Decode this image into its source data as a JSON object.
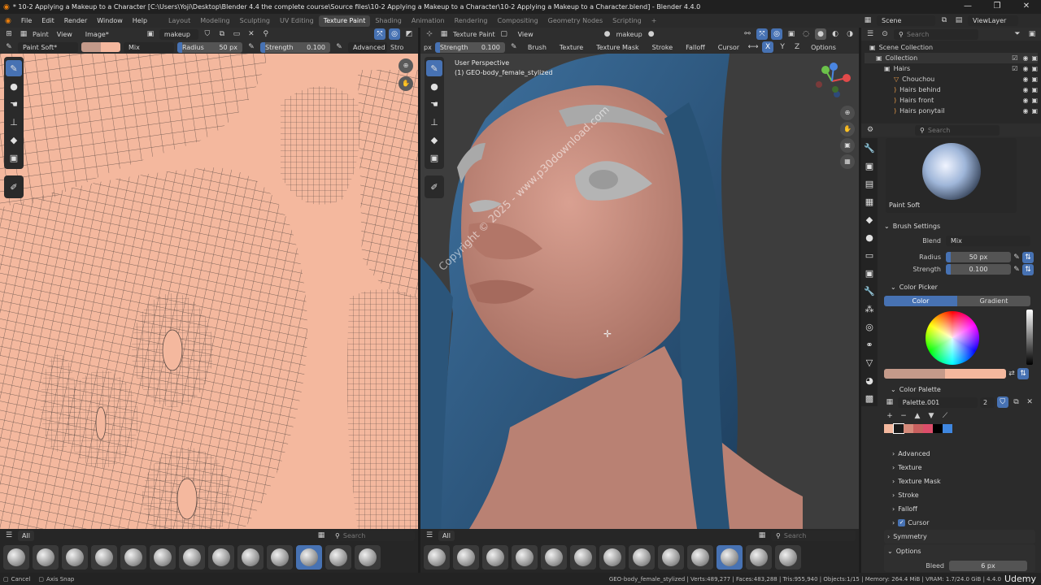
{
  "window": {
    "title": "* 10-2 Applying a Makeup to a Character [C:\\Users\\Yoji\\Desktop\\Blender 4.4 the complete course\\Source files\\10-2 Applying a Makeup to a Character\\10-2 Applying a Makeup to a Character.blend] - Blender 4.4.0",
    "minimize": "—",
    "maximize": "❐",
    "close": "✕"
  },
  "menus": [
    "File",
    "Edit",
    "Render",
    "Window",
    "Help"
  ],
  "workspaces": [
    "Layout",
    "Modeling",
    "Sculpting",
    "UV Editing",
    "Texture Paint",
    "Shading",
    "Animation",
    "Rendering",
    "Compositing",
    "Geometry Nodes",
    "Scripting"
  ],
  "active_workspace": "Texture Paint",
  "add_workspace": "+",
  "scene": {
    "label": "Scene",
    "view_layer": "ViewLayer"
  },
  "uv_header": {
    "mode": "Paint",
    "view": "View",
    "image": "Image*",
    "image_name": "makeup"
  },
  "uv_tool_header": {
    "brush": "Paint Soft*",
    "blend": "Mix",
    "radius_label": "Radius",
    "radius": "50 px",
    "strength_label": "Strength",
    "strength": "0.100",
    "advanced": "Advanced",
    "stroke": "Stro"
  },
  "vp_header": {
    "mode": "Texture Paint",
    "view": "View",
    "image_name": "makeup"
  },
  "vp_tool_header": {
    "radius_partial": "px",
    "strength_label": "Strength",
    "strength": "0.100",
    "menus": [
      "Brush",
      "Texture",
      "Texture Mask",
      "Stroke",
      "Falloff",
      "Cursor"
    ],
    "axes": [
      "X",
      "Y",
      "Z"
    ],
    "options": "Options"
  },
  "viewport": {
    "perspective": "User Perspective",
    "object": "(1) GEO-body_female_stylized"
  },
  "watermark": "Copyright © 2025 - www.p30download.com",
  "shelf": {
    "menu_icon": "☰",
    "all": "All",
    "search_placeholder": "Search"
  },
  "outliner": {
    "search_placeholder": "Search",
    "rows": [
      {
        "name": "Scene Collection",
        "indent": 0
      },
      {
        "name": "Collection",
        "indent": 1
      },
      {
        "name": "Hairs",
        "indent": 2
      },
      {
        "name": "Chouchou",
        "indent": 3
      },
      {
        "name": "Hairs behind",
        "indent": 3
      },
      {
        "name": "Hairs front",
        "indent": 3
      },
      {
        "name": "Hairs ponytail",
        "indent": 3
      }
    ]
  },
  "props": {
    "search_placeholder": "Search",
    "brush_name": "Paint Soft",
    "brush_settings": "Brush Settings",
    "blend_label": "Blend",
    "blend": "Mix",
    "radius_label": "Radius",
    "radius": "50 px",
    "strength_label": "Strength",
    "strength": "0.100",
    "color_picker": "Color Picker",
    "color_tab": "Color",
    "gradient_tab": "Gradient",
    "color_palette": "Color Palette",
    "palette_name": "Palette.001",
    "palette_users": "2",
    "palette_colors": [
      "#f4b89e",
      "#1b1b1b",
      "#d58a7a",
      "#c9605f",
      "#dd4d6a",
      "#000000",
      "#3f87e0"
    ],
    "collapsed_sections": [
      "Advanced",
      "Texture",
      "Texture Mask",
      "Stroke",
      "Falloff"
    ],
    "cursor_section": "Cursor",
    "symmetry": "Symmetry",
    "options": "Options",
    "bleed_label": "Bleed",
    "bleed": "6 px"
  },
  "colors": {
    "accent": "#4772b3",
    "paint_color": "#f4b89e",
    "secondary_color": "#c49a8a",
    "skin": "#c98f80",
    "hair": "#2e5a82"
  },
  "status": {
    "left1": "Cancel",
    "left2": "Axis Snap",
    "right": "GEO-body_female_stylized | Verts:489,277 | Faces:483,288 | Tris:955,940 | Objects:1/15 | Memory: 264.4 MiB | VRAM: 1.7/24.0 GiB | 4.4.0",
    "brand": "Udemy"
  }
}
